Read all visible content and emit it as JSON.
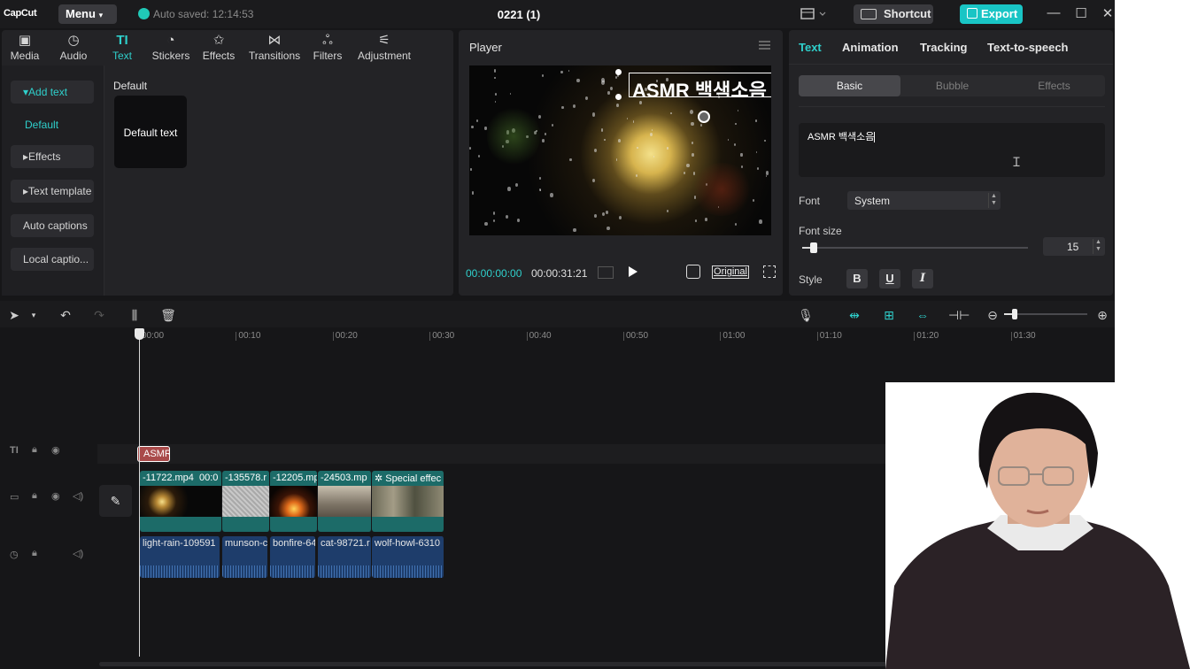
{
  "app": {
    "logo": "CapCut",
    "menu_label": "Menu",
    "saved_text": "Auto saved: 12:14:53",
    "project_title": "0221 (1)",
    "shortcut_label": "Shortcut",
    "export_label": "Export"
  },
  "toolbar": {
    "tabs": [
      {
        "label": "Media",
        "icon": "media-icon"
      },
      {
        "label": "Audio",
        "icon": "audio-icon"
      },
      {
        "label": "Text",
        "icon": "text-icon"
      },
      {
        "label": "Stickers",
        "icon": "stickers-icon"
      },
      {
        "label": "Effects",
        "icon": "effects-icon"
      },
      {
        "label": "Transitions",
        "icon": "transitions-icon"
      },
      {
        "label": "Filters",
        "icon": "filters-icon"
      },
      {
        "label": "Adjustment",
        "icon": "adjustment-icon"
      }
    ],
    "active": "Text"
  },
  "sidebar": {
    "items": [
      {
        "label": "Add text"
      },
      {
        "label": "Default"
      },
      {
        "label": "Effects"
      },
      {
        "label": "Text template"
      },
      {
        "label": "Auto captions"
      },
      {
        "label": "Local captio..."
      }
    ]
  },
  "content": {
    "section_label": "Default",
    "card_label": "Default text"
  },
  "player": {
    "title": "Player",
    "overlay_text": "ASMR 백색소음",
    "current_time": "00:00:00:00",
    "total_time": "00:00:31:21",
    "original_label": "Original"
  },
  "inspector": {
    "tabs": [
      "Text",
      "Animation",
      "Tracking",
      "Text-to-speech"
    ],
    "segments": [
      "Basic",
      "Bubble",
      "Effects"
    ],
    "text_value": "ASMR 백색소음",
    "font_label": "Font",
    "font_value": "System",
    "font_size_label": "Font size",
    "font_size_value": "15",
    "font_size_level": 0.05,
    "style_label": "Style",
    "style_buttons": [
      "B",
      "U",
      "I"
    ]
  },
  "timeline": {
    "ruler": [
      "00:00",
      "00:10",
      "00:20",
      "00:30",
      "00:40",
      "00:50",
      "01:00",
      "01:10",
      "01:20",
      "01:30"
    ],
    "text_clip": "ASMR",
    "video_clips": [
      "-11722.mp4",
      "00:0",
      "-135578.r",
      "-12205.mp",
      "-24503.mp",
      "Special effec"
    ],
    "audio_clips": [
      "light-rain-109591",
      "munson-c",
      "bonfire-64",
      "cat-98721.r",
      "wolf-howl-6310"
    ],
    "zoom_level": 0.13
  }
}
